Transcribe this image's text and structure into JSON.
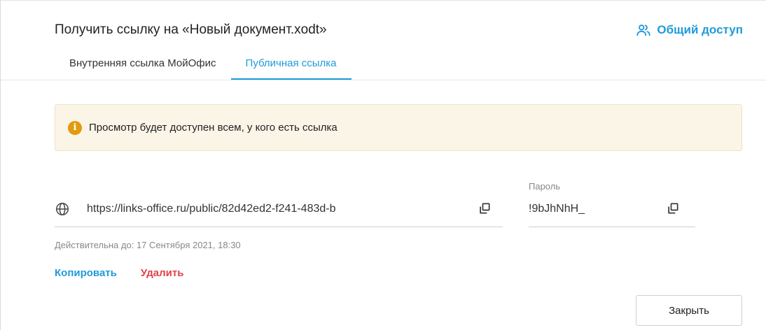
{
  "dialog": {
    "title": "Получить ссылку на «Новый документ.xodt»",
    "share_link_label": "Общий доступ"
  },
  "tabs": [
    {
      "label": "Внутренняя ссылка МойОфис",
      "active": false
    },
    {
      "label": "Публичная ссылка",
      "active": true
    }
  ],
  "notice": {
    "icon": "info-icon",
    "icon_glyph": "i",
    "text": "Просмотр будет доступен всем, у кого есть ссылка"
  },
  "link": {
    "url": "https://links-office.ru/public/82d42ed2-f241-483d-b",
    "valid_until": "Действительна до: 17 Сентября 2021, 18:30"
  },
  "password": {
    "label": "Пароль",
    "value": "!9bJhNhH_"
  },
  "actions": {
    "copy_label": "Копировать",
    "delete_label": "Удалить"
  },
  "footer": {
    "close_label": "Закрыть"
  },
  "colors": {
    "accent": "#1e9bd9",
    "danger": "#e0424a",
    "notice_bg": "#fbf5e8",
    "notice_icon": "#e39a0f"
  }
}
